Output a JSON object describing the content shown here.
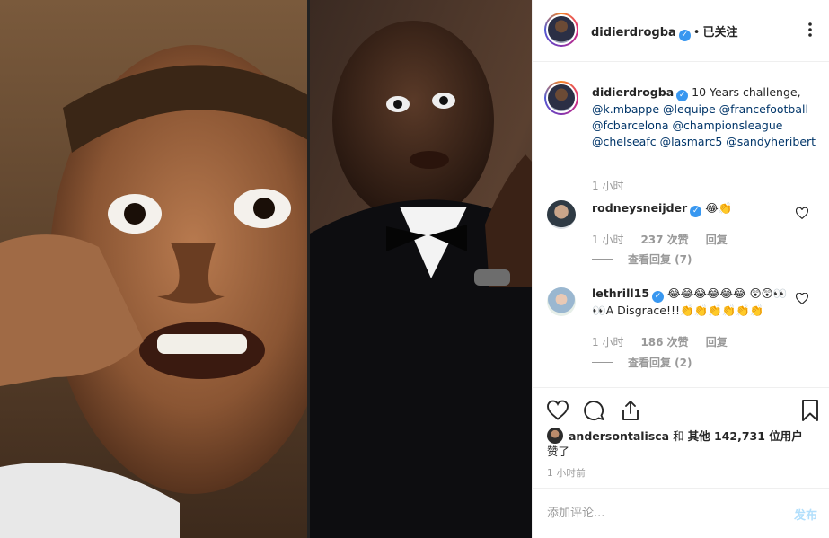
{
  "post": {
    "author": "didierdrogba",
    "follow_status": "已关注",
    "caption_username": "didierdrogba",
    "caption_text": "10 Years challenge,",
    "caption_mentions": [
      "@k.mbappe",
      "@lequipe",
      "@francefootball",
      "@fcbarcelona",
      "@championsleague",
      "@chelseafc",
      "@lasmarc5",
      "@sandyheribert"
    ],
    "caption_time": "1 小时",
    "accent_color": "#3897f0"
  },
  "comments": [
    {
      "username": "rodneysneijder",
      "verified": true,
      "text": "😂👏",
      "time": "1 小时",
      "likes": "237 次赞",
      "reply_label": "回复",
      "view_replies": "查看回复 (7)"
    },
    {
      "username": "lethrill15",
      "verified": true,
      "text": "😂😂😂😂😂😂 😲😲👀👀A Disgrace!!!👏👏👏👏👏👏",
      "time": "1 小时",
      "likes": "186 次赞",
      "reply_label": "回复",
      "view_replies": "查看回复 (2)"
    }
  ],
  "likes": {
    "first_liker": "andersontalisca",
    "connector": "和",
    "others_prefix": "其他",
    "count_text": "142,731 位用户",
    "suffix": "赞了"
  },
  "posted_time": "1 小时前",
  "add_comment": {
    "placeholder": "添加评论...",
    "post_label": "发布"
  },
  "icons": {
    "more": "more-icon",
    "verified": "verified-badge-icon",
    "like": "heart-icon",
    "comment": "comment-icon",
    "share": "share-icon",
    "save": "bookmark-icon"
  }
}
